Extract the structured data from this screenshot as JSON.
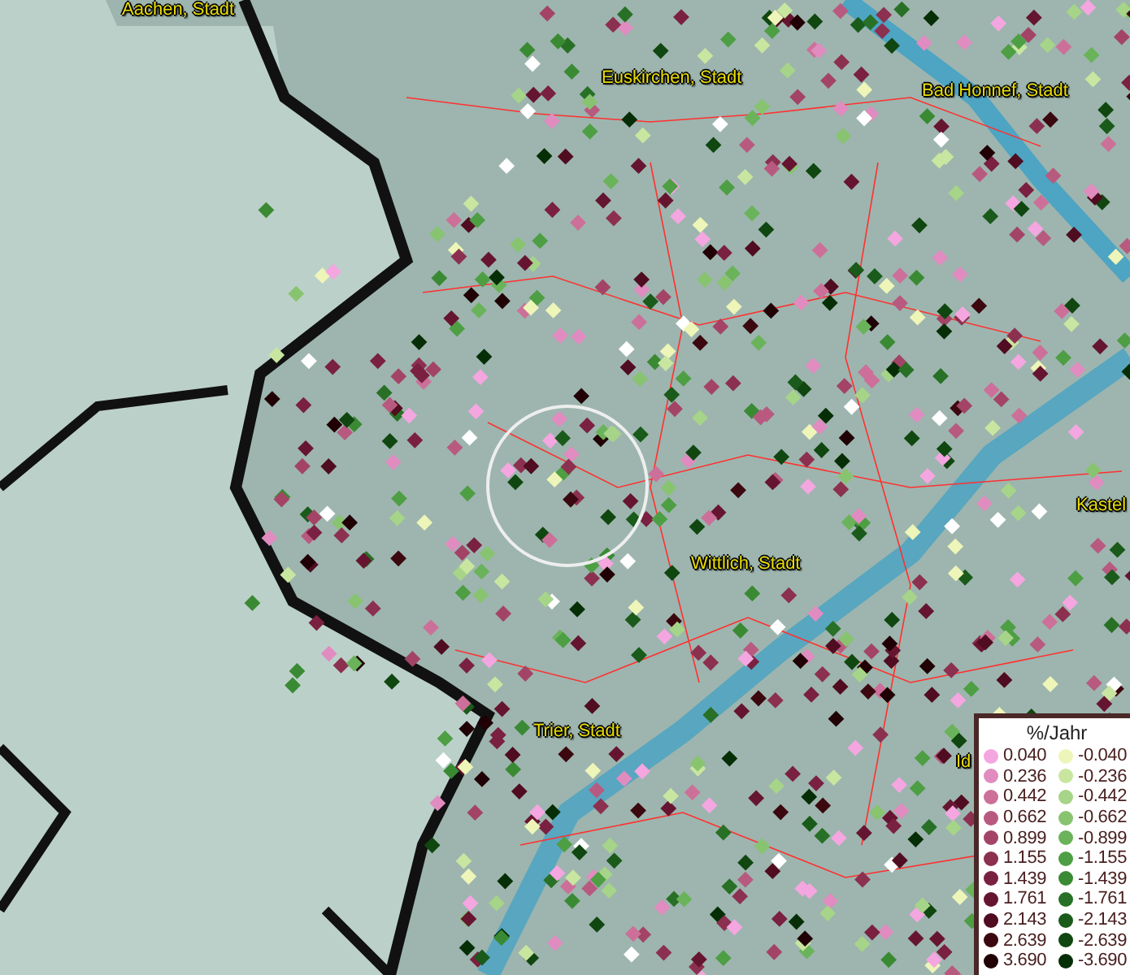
{
  "map": {
    "labels": [
      {
        "text": "Aachen, Stadt"
      },
      {
        "text": "Euskirchen, Stadt"
      },
      {
        "text": "Bad Honnef, Stadt"
      },
      {
        "text": "Kastel"
      },
      {
        "text": "Wittlich, Stadt"
      },
      {
        "text": "Trier, Stadt"
      },
      {
        "text": "Id"
      }
    ]
  },
  "legend": {
    "title": "%/Jahr",
    "items": [
      {
        "value": "0.040",
        "color": "#f4a6e0"
      },
      {
        "value": "-0.040",
        "color": "#eef5b8"
      },
      {
        "value": "0.236",
        "color": "#e08cc0"
      },
      {
        "value": "-0.236",
        "color": "#c8e6a0"
      },
      {
        "value": "0.442",
        "color": "#cc7099"
      },
      {
        "value": "-0.442",
        "color": "#a6d488"
      },
      {
        "value": "0.662",
        "color": "#b85a80"
      },
      {
        "value": "-0.662",
        "color": "#88c470"
      },
      {
        "value": "0.899",
        "color": "#a34466"
      },
      {
        "value": "-0.899",
        "color": "#6ab35a"
      },
      {
        "value": "1.155",
        "color": "#8c3050"
      },
      {
        "value": "-1.155",
        "color": "#4e9e44"
      },
      {
        "value": "1.439",
        "color": "#7a2040"
      },
      {
        "value": "-1.439",
        "color": "#3a8a34"
      },
      {
        "value": "1.761",
        "color": "#661530"
      },
      {
        "value": "-1.761",
        "color": "#287026"
      },
      {
        "value": "2.143",
        "color": "#500c20"
      },
      {
        "value": "-2.143",
        "color": "#1a5a1a"
      },
      {
        "value": "2.639",
        "color": "#3c0810"
      },
      {
        "value": "-2.639",
        "color": "#104610"
      },
      {
        "value": "3.690",
        "color": "#200005"
      },
      {
        "value": "-3.690",
        "color": "#062e06"
      }
    ]
  }
}
